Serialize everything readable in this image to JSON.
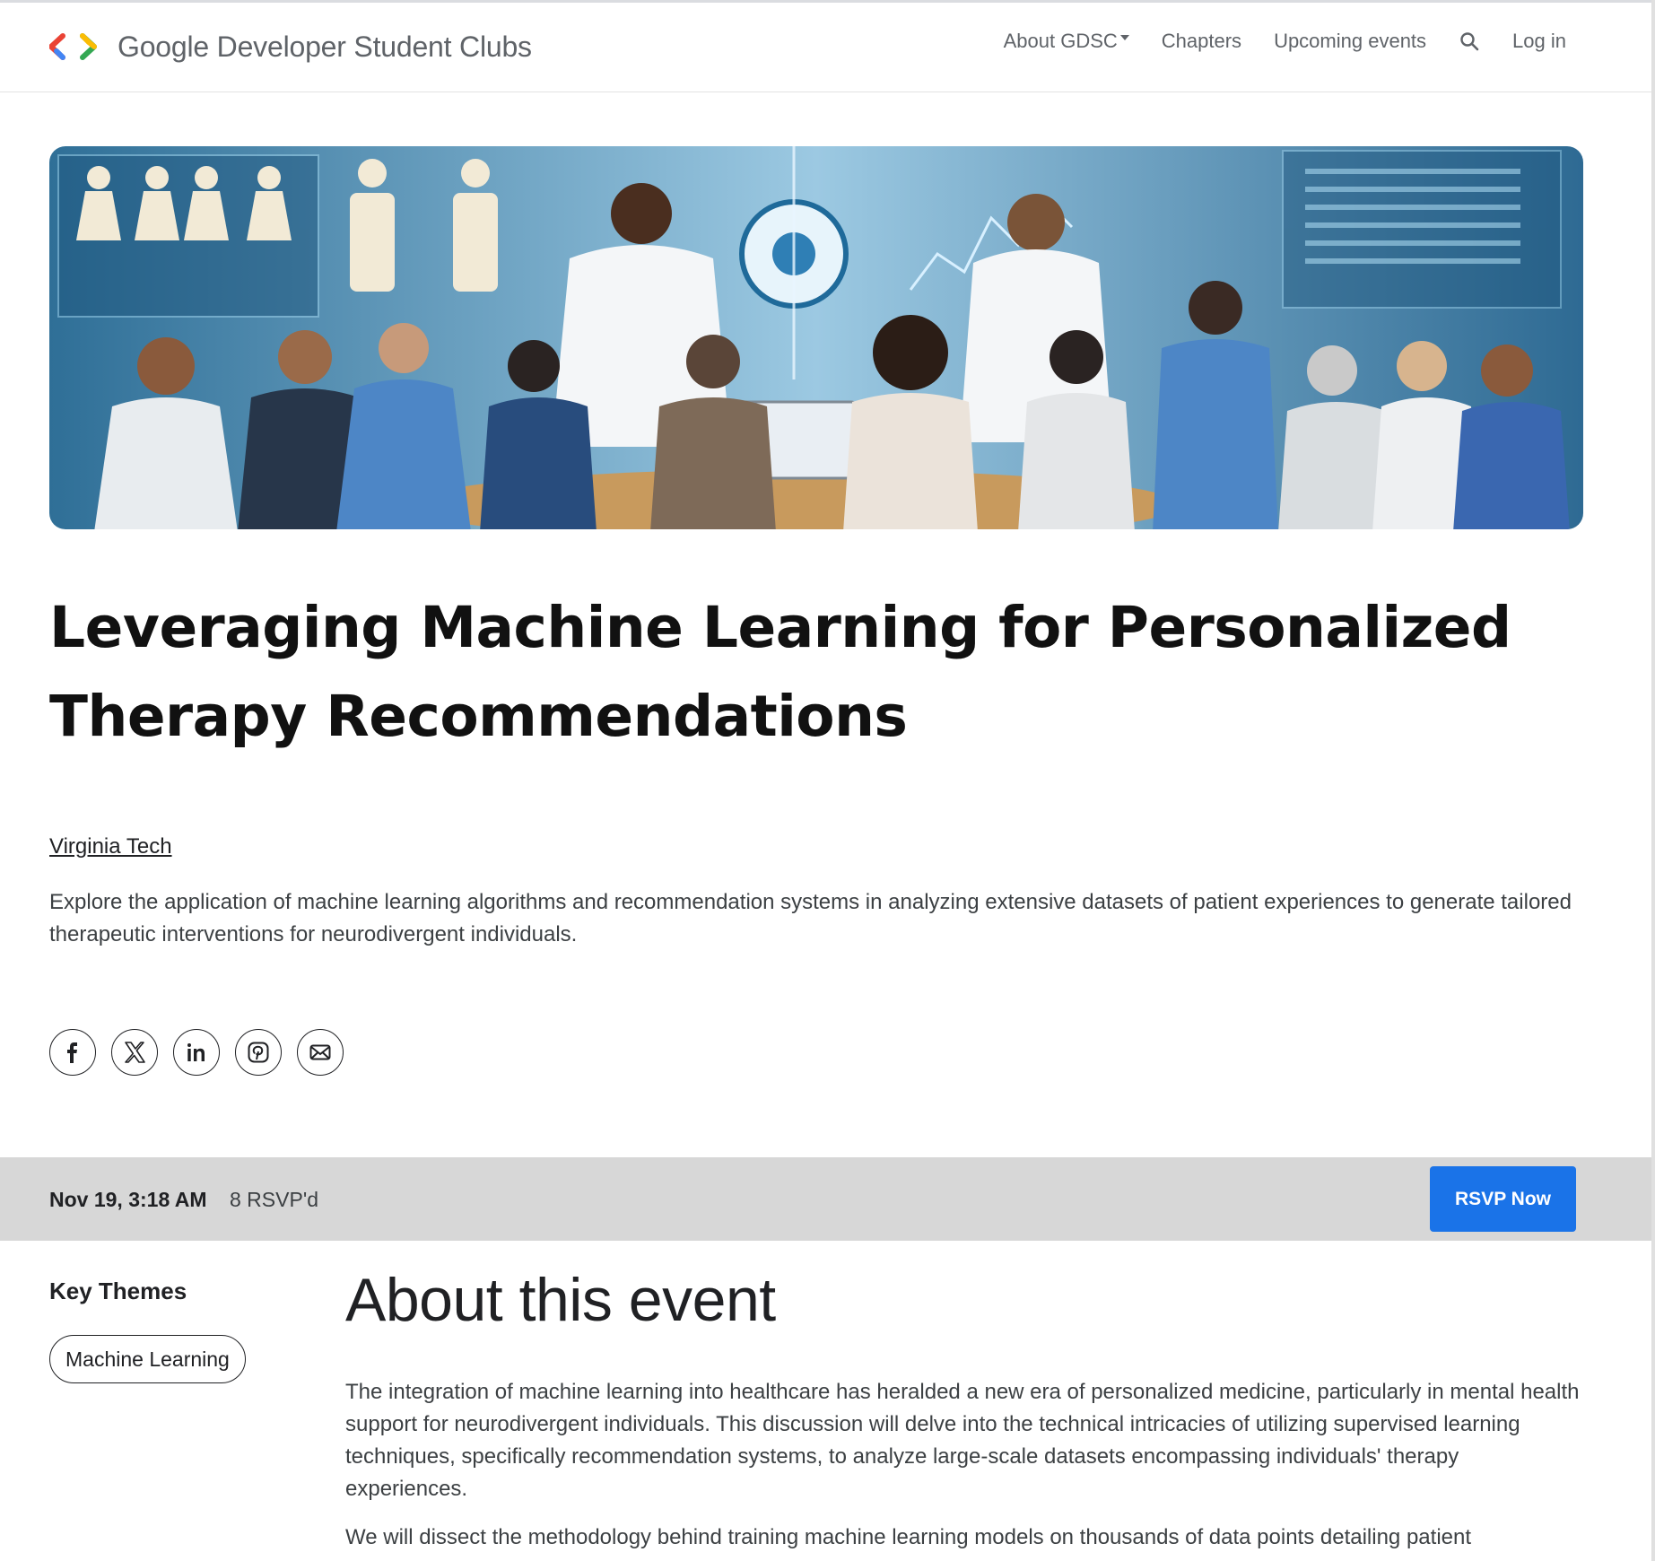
{
  "nav": {
    "brand": "Google Developer Student Clubs",
    "links": [
      "About GDSC",
      "Chapters",
      "Upcoming events"
    ],
    "login": "Log in"
  },
  "hero": {
    "icon": "hero-image",
    "alt_colors": [
      "#1f6a9a",
      "#7fb6d6",
      "#e9f2f8"
    ]
  },
  "event": {
    "title": "Leveraging Machine Learning for Personalized Therapy Recommendations",
    "chapter": "Virginia Tech",
    "description": "Explore the application of machine learning algorithms and recommendation systems in analyzing extensive datasets of patient experiences to generate tailored therapeutic interventions for neurodivergent individuals."
  },
  "share": [
    "facebook-icon",
    "x-icon",
    "linkedin-icon",
    "pinterest-icon",
    "email-icon"
  ],
  "bar": {
    "date": "Nov 19, 3:18 AM",
    "rsvp_count": "8 RSVP'd",
    "rsvp_button": "RSVP Now",
    "button_color": "#1a73e8"
  },
  "themes": {
    "heading": "Key Themes",
    "items": [
      "Machine Learning"
    ]
  },
  "about": {
    "heading": "About this event",
    "paragraphs": [
      "The integration of machine learning into healthcare has heralded a new era of personalized medicine, particularly in mental health support for neurodivergent individuals. This discussion will delve into the technical intricacies of utilizing supervised learning techniques, specifically recommendation systems, to analyze large-scale datasets encompassing individuals' therapy experiences.",
      "We will dissect the methodology behind training machine learning models on thousands of data points detailing patient"
    ]
  }
}
